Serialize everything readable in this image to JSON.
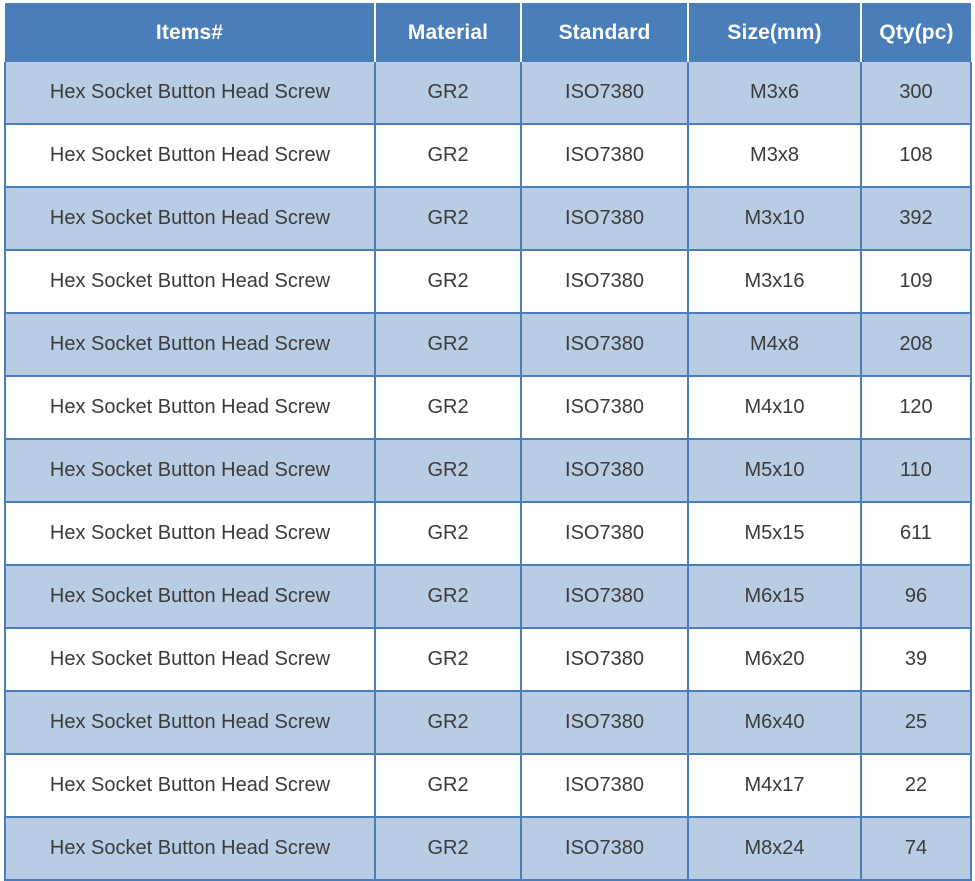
{
  "table": {
    "columns": [
      {
        "key": "item",
        "label": "Items#"
      },
      {
        "key": "material",
        "label": "Material"
      },
      {
        "key": "standard",
        "label": "Standard"
      },
      {
        "key": "size",
        "label": "Size(mm)"
      },
      {
        "key": "qty",
        "label": "Qty(pc)"
      }
    ],
    "rows": [
      {
        "item": "Hex Socket Button Head Screw",
        "material": "GR2",
        "standard": "ISO7380",
        "size": "M3x6",
        "qty": "300"
      },
      {
        "item": "Hex Socket Button Head Screw",
        "material": "GR2",
        "standard": "ISO7380",
        "size": "M3x8",
        "qty": "108"
      },
      {
        "item": "Hex Socket Button Head Screw",
        "material": "GR2",
        "standard": "ISO7380",
        "size": "M3x10",
        "qty": "392"
      },
      {
        "item": "Hex Socket Button Head Screw",
        "material": "GR2",
        "standard": "ISO7380",
        "size": "M3x16",
        "qty": "109"
      },
      {
        "item": "Hex Socket Button Head Screw",
        "material": "GR2",
        "standard": "ISO7380",
        "size": "M4x8",
        "qty": "208"
      },
      {
        "item": "Hex Socket Button Head Screw",
        "material": "GR2",
        "standard": "ISO7380",
        "size": "M4x10",
        "qty": "120"
      },
      {
        "item": "Hex Socket Button Head Screw",
        "material": "GR2",
        "standard": "ISO7380",
        "size": "M5x10",
        "qty": "110"
      },
      {
        "item": "Hex Socket Button Head Screw",
        "material": "GR2",
        "standard": "ISO7380",
        "size": "M5x15",
        "qty": "611"
      },
      {
        "item": "Hex Socket Button Head Screw",
        "material": "GR2",
        "standard": "ISO7380",
        "size": "M6x15",
        "qty": "96"
      },
      {
        "item": "Hex Socket Button Head Screw",
        "material": "GR2",
        "standard": "ISO7380",
        "size": "M6x20",
        "qty": "39"
      },
      {
        "item": "Hex Socket Button Head Screw",
        "material": "GR2",
        "standard": "ISO7380",
        "size": "M6x40",
        "qty": "25"
      },
      {
        "item": "Hex Socket Button Head Screw",
        "material": "GR2",
        "standard": "ISO7380",
        "size": "M4x17",
        "qty": "22"
      },
      {
        "item": "Hex Socket Button Head Screw",
        "material": "GR2",
        "standard": "ISO7380",
        "size": "M8x24",
        "qty": "74"
      }
    ]
  },
  "colors": {
    "header_background": "#4A7EBB",
    "header_text": "#FFFFFF",
    "banded_row_background": "#B8CCE4",
    "plain_row_background": "#FFFFFF",
    "border": "#4A7EBB",
    "cell_text": "#3B3B3B"
  }
}
